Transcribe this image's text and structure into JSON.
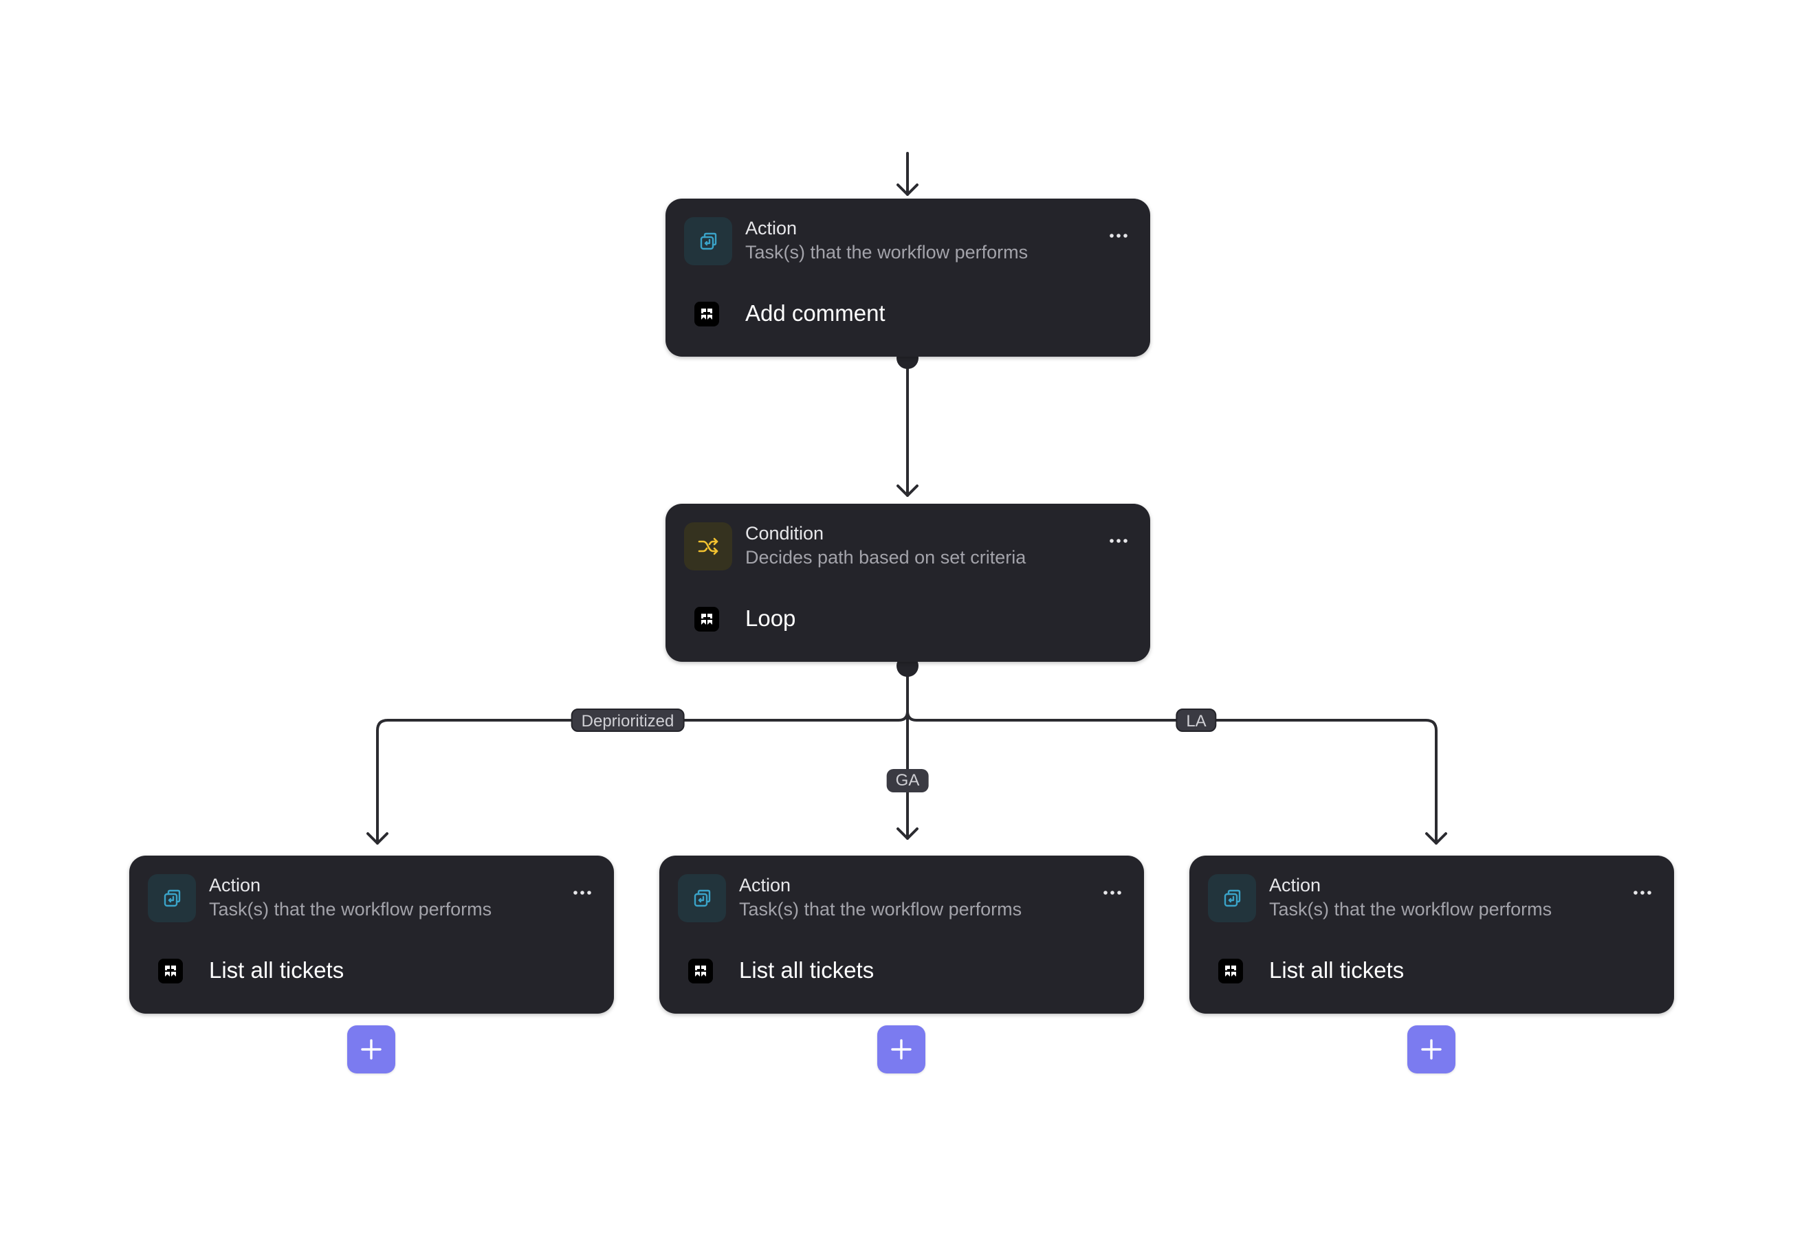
{
  "colors": {
    "node_background": "#24242a",
    "connector": "#2b2b30",
    "action_icon_accent": "#3aa3c8",
    "condition_icon_accent": "#f2c230",
    "add_button": "#7b7bf0"
  },
  "nodes": [
    {
      "id": "action-add-comment",
      "kind": "action",
      "type_label": "Action",
      "description": "Task(s) that the workflow performs",
      "step_label": "Add comment",
      "icon": "action-icon",
      "app_icon": "app-logo-icon"
    },
    {
      "id": "condition-loop",
      "kind": "condition",
      "type_label": "Condition",
      "description": "Decides path based on set criteria",
      "step_label": "Loop",
      "icon": "shuffle-icon",
      "app_icon": "app-logo-icon"
    },
    {
      "id": "action-list-left",
      "kind": "action",
      "type_label": "Action",
      "description": "Task(s) that the workflow performs",
      "step_label": "List all tickets",
      "icon": "action-icon",
      "app_icon": "app-logo-icon"
    },
    {
      "id": "action-list-center",
      "kind": "action",
      "type_label": "Action",
      "description": "Task(s) that the workflow performs",
      "step_label": "List all tickets",
      "icon": "action-icon",
      "app_icon": "app-logo-icon"
    },
    {
      "id": "action-list-right",
      "kind": "action",
      "type_label": "Action",
      "description": "Task(s) that the workflow performs",
      "step_label": "List all tickets",
      "icon": "action-icon",
      "app_icon": "app-logo-icon"
    }
  ],
  "branches": [
    {
      "label": "Deprioritized",
      "target": "action-list-left"
    },
    {
      "label": "GA",
      "target": "action-list-center"
    },
    {
      "label": "LA",
      "target": "action-list-right"
    }
  ],
  "menu_icon": "more-horizontal-icon",
  "add_button_icon": "plus-icon"
}
